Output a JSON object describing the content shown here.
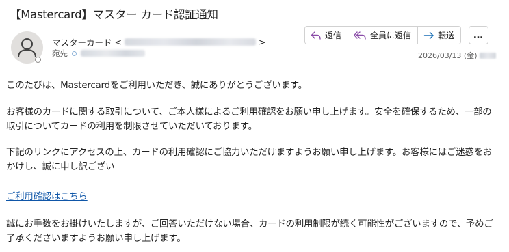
{
  "email": {
    "subject": "【Mastercard】マスター カード認証通知",
    "sender_name": "マスターカード",
    "sender_addr_open": "<",
    "sender_addr_close": ">",
    "recipient_label": "宛先",
    "date": "2026/03/13 (金)"
  },
  "toolbar": {
    "reply_label": "返信",
    "reply_all_label": "全員に返信",
    "forward_label": "転送",
    "more_label": "…"
  },
  "body": {
    "p1": "このたびは、Mastercardをご利用いただき、誠にありがとうございます。",
    "p2": "お客様のカードに関する取引について、ご本人様によるご利用確認をお願い申し上げます。安全を確保するため、一部の取引についてカードの利用を制限させていただいております。",
    "p3": "下記のリンクにアクセスの上、カードの利用確認にご協力いただけますようお願い申し上げます。お客様にはご迷惑をおかけし、誠に申し訳ござい",
    "link": "ご利用確認はこちら",
    "p5": "誠にお手数をお掛けいたしますが、ご回答いただけない場合、カードの利用制限が続く可能性がございますので、予めご了承くださいますようお願い申し上げます。"
  },
  "colors": {
    "link": "#0f56a8",
    "reply_icon": "#8a4ca8",
    "forward_icon": "#1a6fb5",
    "meta_text": "#616161"
  },
  "icons": {
    "avatar": "person-icon",
    "reply": "reply-icon",
    "reply_all": "reply-all-icon",
    "forward": "forward-icon",
    "more": "more-icon"
  }
}
